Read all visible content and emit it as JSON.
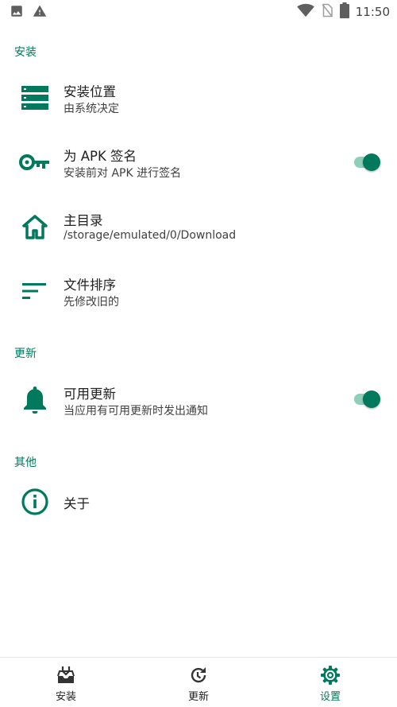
{
  "status_bar": {
    "time": "11:50"
  },
  "sections": {
    "install": "安装",
    "update": "更新",
    "other": "其他"
  },
  "prefs": {
    "install_location": {
      "title": "安装位置",
      "summary": "由系统决定",
      "icon": "storage-icon"
    },
    "sign_apk": {
      "title": "为 APK 签名",
      "summary": "安装前对 APK 进行签名",
      "icon": "key-icon",
      "enabled": true
    },
    "home_dir": {
      "title": "主目录",
      "summary": "/storage/emulated/0/Download",
      "icon": "home-icon"
    },
    "file_sort": {
      "title": "文件排序",
      "summary": "先修改旧的",
      "icon": "sort-icon"
    },
    "available_updates": {
      "title": "可用更新",
      "summary": "当应用有可用更新时发出通知",
      "icon": "bell-icon",
      "enabled": true
    },
    "about": {
      "title": "关于",
      "icon": "info-icon"
    }
  },
  "bottom_nav": {
    "items": [
      {
        "label": "安装",
        "icon": "install-tray-icon"
      },
      {
        "label": "更新",
        "icon": "update-history-icon"
      },
      {
        "label": "设置",
        "icon": "settings-gear-icon",
        "active": true
      }
    ]
  },
  "colors": {
    "accent": "#00795c",
    "switch_track": "#8fcfb9"
  }
}
